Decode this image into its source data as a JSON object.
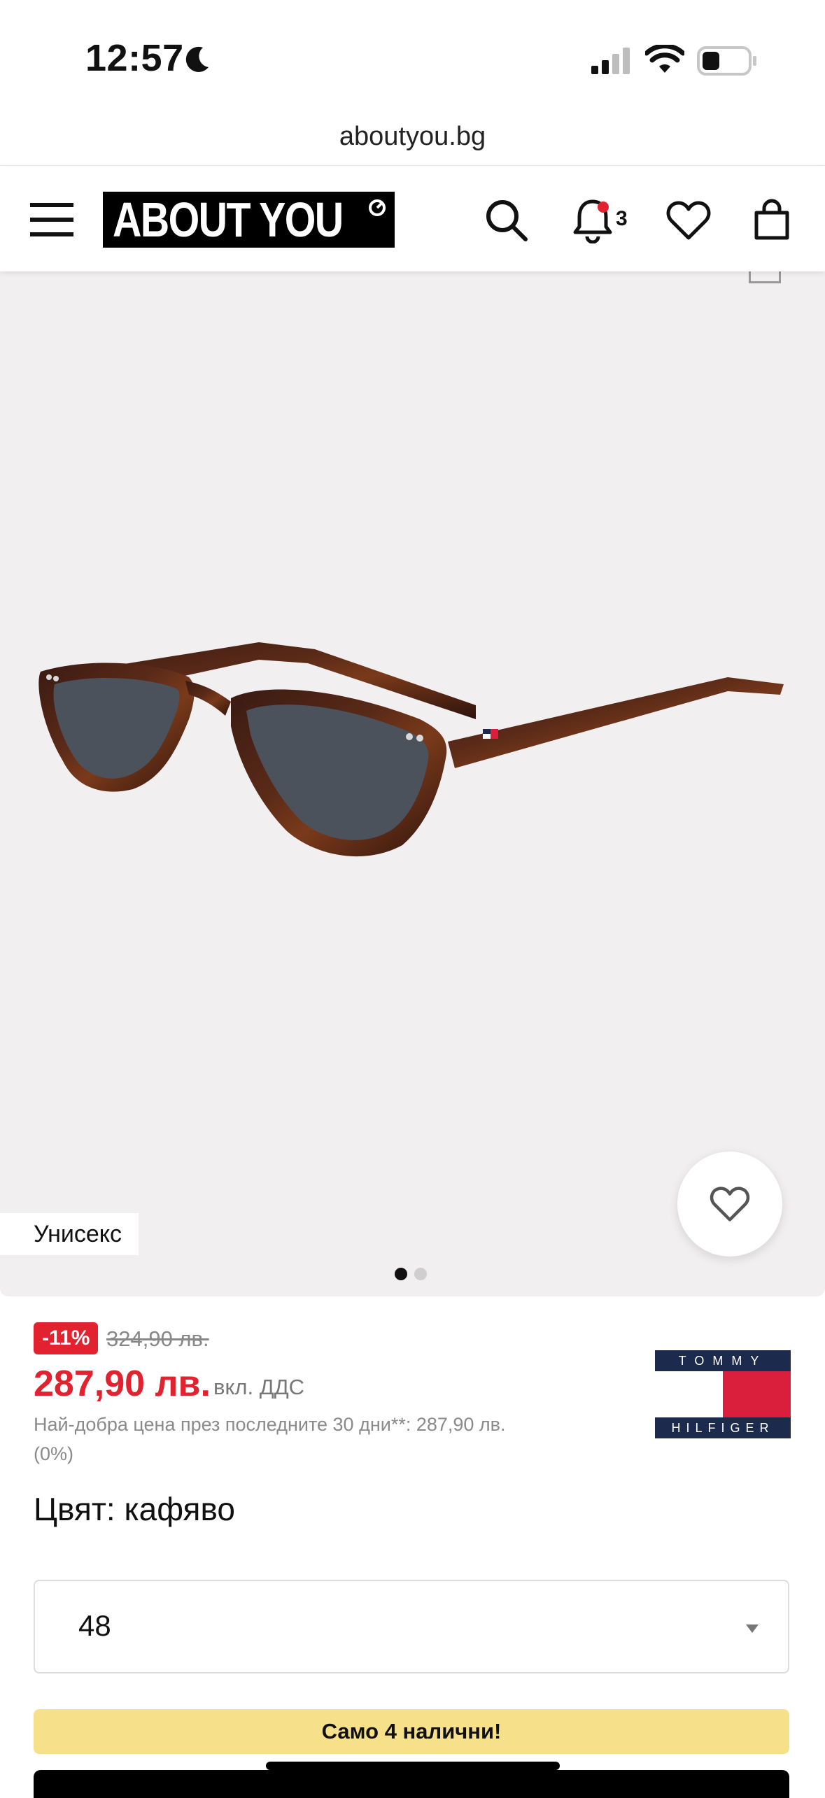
{
  "status_bar": {
    "time": "12:57"
  },
  "browser": {
    "url": "aboutyou.bg"
  },
  "header": {
    "logo_text": "ABOUT YOU",
    "notification_count": "3"
  },
  "gallery": {
    "gender_label": "Унисекс",
    "image_count": 2,
    "active_index": 0
  },
  "pricing": {
    "discount": "-11%",
    "old_price": "324,90 лв.",
    "price": "287,90 лв.",
    "vat_note": "вкл. ДДС",
    "best_price_note": "Най-добра цена през последните 30 дни**: 287,90 лв. (0%)"
  },
  "brand": {
    "top_text": "TOMMY",
    "bottom_text": "HILFIGER",
    "colors": {
      "navy": "#1c2a4e",
      "red": "#d91f3c",
      "white": "#ffffff"
    }
  },
  "product": {
    "color_label": "Цвят: кафяво",
    "size_selected": "48",
    "stock_message": "Само 4 налични!"
  },
  "theme": {
    "sale_red": "#e2232f",
    "banner_yellow": "#f7e08a",
    "gallery_bg": "#f2eff1"
  }
}
